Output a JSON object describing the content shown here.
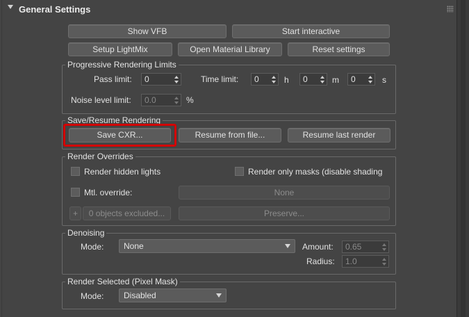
{
  "rollout": {
    "title": "General Settings"
  },
  "top_buttons": {
    "show_vfb": "Show VFB",
    "start_interactive": "Start interactive",
    "setup_lightmix": "Setup LightMix",
    "open_material_library": "Open Material Library",
    "reset_settings": "Reset settings"
  },
  "progressive": {
    "title": "Progressive Rendering Limits",
    "pass_limit_label": "Pass limit:",
    "pass_limit_value": "0",
    "time_limit_label": "Time limit:",
    "hours_value": "0",
    "hours_unit": "h",
    "minutes_value": "0",
    "minutes_unit": "m",
    "seconds_value": "0",
    "seconds_unit": "s",
    "noise_label": "Noise level limit:",
    "noise_value": "0.0",
    "noise_unit": "%"
  },
  "save_resume": {
    "title": "Save/Resume Rendering",
    "save_cxr": "Save CXR...",
    "resume_from_file": "Resume from file...",
    "resume_last_render": "Resume last render"
  },
  "overrides": {
    "title": "Render Overrides",
    "render_hidden_lights": "Render hidden lights",
    "render_only_masks": "Render only masks (disable shading",
    "mtl_override": "Mtl. override:",
    "mtl_value": "None",
    "plus_symbol": "+",
    "objects_excluded": "0 objects excluded...",
    "preserve": "Preserve..."
  },
  "denoising": {
    "title": "Denoising",
    "mode_label": "Mode:",
    "mode_value": "None",
    "amount_label": "Amount:",
    "amount_value": "0.65",
    "radius_label": "Radius:",
    "radius_value": "1.0"
  },
  "render_selected": {
    "title": "Render Selected (Pixel Mask)",
    "mode_label": "Mode:",
    "mode_value": "Disabled"
  },
  "colors": {
    "panel_bg": "#444444",
    "highlight": "#d30000"
  }
}
